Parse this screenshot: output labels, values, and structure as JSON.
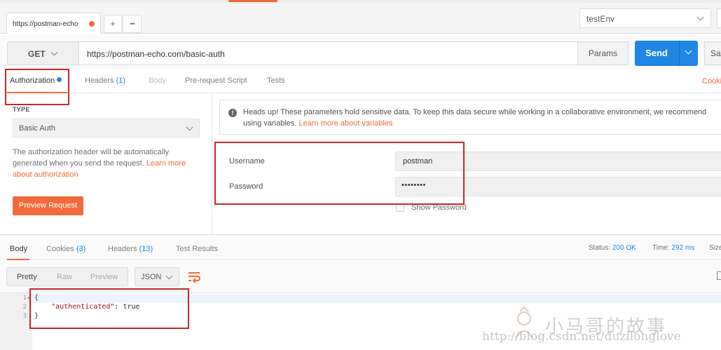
{
  "tabs": {
    "active_label": "https://postman-echo",
    "add_symbol": "+",
    "more_symbol": "•••"
  },
  "environment": {
    "selected": "testEnv"
  },
  "request": {
    "method": "GET",
    "url": "https://postman-echo.com/basic-auth",
    "params_label": "Params",
    "send_label": "Send",
    "save_label": "Sav"
  },
  "request_tabs": {
    "authorization": "Authorization",
    "headers": "Headers",
    "headers_count": "(1)",
    "body": "Body",
    "prerequest": "Pre-request Script",
    "tests": "Tests",
    "cookies": "Cooki"
  },
  "auth": {
    "type_heading": "TYPE",
    "type_value": "Basic Auth",
    "description": "The authorization header will be automatically generated when you send the request. ",
    "learn_more": "Learn more about authorization",
    "preview_button": "Preview Request",
    "notice_text": "Heads up! These parameters hold sensitive data. To keep this data secure while working in a collaborative environment, we recommend",
    "notice_text2": "using variables. ",
    "notice_link": "Learn more about variables",
    "username_label": "Username",
    "username_value": "postman",
    "password_label": "Password",
    "password_value": "••••••••",
    "show_password": "Show Password"
  },
  "response": {
    "tabs": {
      "body": "Body",
      "cookies": "Cookies",
      "cookies_count": "(3)",
      "headers": "Headers",
      "headers_count": "(13)",
      "test_results": "Test Results"
    },
    "status_label": "Status:",
    "status_value": "200 OK",
    "time_label": "Time:",
    "time_value": "292 ms",
    "size_label": "Size",
    "view_modes": {
      "pretty": "Pretty",
      "raw": "Raw",
      "preview": "Preview"
    },
    "format": "JSON",
    "lines": [
      "1",
      "2",
      "3"
    ],
    "code": {
      "open": "{",
      "key": "\"authenticated\"",
      "sep": ": ",
      "value": "true",
      "close": "}"
    }
  },
  "watermark": {
    "title": "小马哥的故事",
    "url": "http://blog.csdn.net/duzilonglove"
  },
  "colors": {
    "accent": "#f26b3a",
    "primary": "#1f86e6",
    "annotation": "#c8282c"
  }
}
